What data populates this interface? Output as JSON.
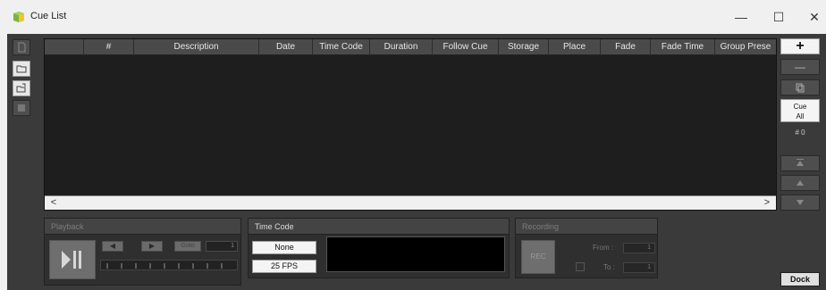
{
  "window": {
    "title": "Cue List",
    "icon": "cube-icon",
    "controls": {
      "minimize": "—",
      "maximize": "☐",
      "close": "✕"
    }
  },
  "left_toolbar": [
    {
      "name": "new-icon",
      "active": true
    },
    {
      "name": "open-folder-icon",
      "active": true
    },
    {
      "name": "export-folder-icon",
      "active": true
    },
    {
      "name": "save-icon",
      "active": false
    }
  ],
  "table": {
    "columns": [
      "",
      "#",
      "Description",
      "Date",
      "Time Code",
      "Duration",
      "Follow Cue",
      "Storage",
      "Place",
      "Fade",
      "Fade Time",
      "Group Prese"
    ],
    "rows": [],
    "scroll_left": "<",
    "scroll_right": ">"
  },
  "right_toolbar": {
    "add_label": "+",
    "remove_label": "—",
    "copy_icon": "copy-icon",
    "cue_all_line1": "Cue",
    "cue_all_line2": "All",
    "cue_count": "# 0",
    "move_top_icon": "move-to-top-icon",
    "move_up_icon": "move-up-icon",
    "move_down_icon": "move-down-icon"
  },
  "playback": {
    "title": "Playback",
    "prev_label": "◀",
    "next_label": "▶",
    "goto_label": "Goto",
    "goto_value": "1"
  },
  "time_code": {
    "title": "Time Code",
    "source": "None",
    "fps": "25 FPS"
  },
  "recording": {
    "title": "Recording",
    "rec_label": "REC",
    "from_label": "From :",
    "from_value": "1",
    "to_label": "To :",
    "to_value": "1"
  },
  "dock": {
    "label": "Dock"
  },
  "colors": {
    "panel": "#3a3a3a",
    "table_bg": "#1e1e1e",
    "header_bg": "#4a4a4a",
    "highlight_button": "#f4f4f4",
    "icon_green": "#7cb342",
    "icon_yellow": "#f4c430"
  }
}
